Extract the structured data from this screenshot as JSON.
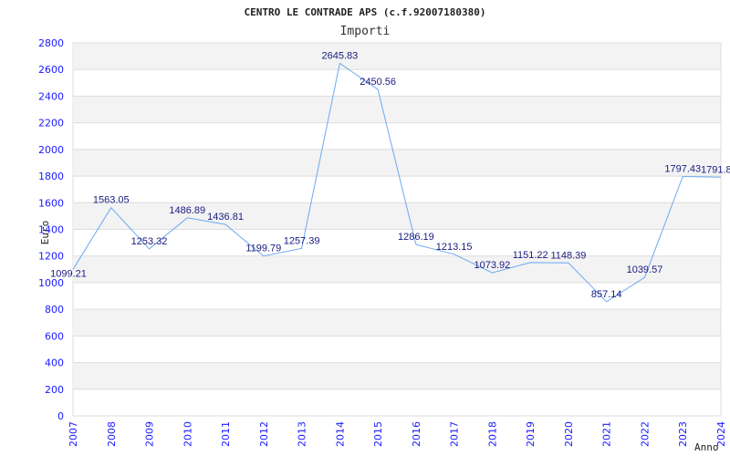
{
  "chart_data": {
    "type": "line",
    "title": "CENTRO LE CONTRADE APS (c.f.92007180380)",
    "subtitle": "Importi",
    "xlabel": "Anno",
    "ylabel": "Euro",
    "ylim": [
      0,
      2800
    ],
    "yticks": [
      "0",
      "200",
      "400",
      "600",
      "800",
      "1000",
      "1200",
      "1400",
      "1600",
      "1800",
      "2000",
      "2200",
      "2400",
      "2600",
      "2800"
    ],
    "categories": [
      "2007",
      "2008",
      "2009",
      "2010",
      "2011",
      "2012",
      "2013",
      "2014",
      "2015",
      "2016",
      "2017",
      "2018",
      "2019",
      "2020",
      "2021",
      "2022",
      "2023",
      "2024"
    ],
    "values": [
      1099.21,
      1563.05,
      1253.32,
      1486.89,
      1436.81,
      1199.79,
      1257.39,
      2645.83,
      2450.56,
      1286.19,
      1213.15,
      1073.92,
      1151.22,
      1148.39,
      857.14,
      1039.57,
      1797.43,
      1791.8
    ],
    "labels": [
      "1099.21",
      "1563.05",
      "1253.32",
      "1486.89",
      "1436.81",
      "1199.79",
      "1257.39",
      "2645.83",
      "2450.56",
      "1286.19",
      "1213.15",
      "1073.92",
      "1151.22",
      "1148.39",
      "857.14",
      "1039.57",
      "1797.43",
      "1791.8"
    ],
    "grid": true,
    "line_color": "#6aaaf0",
    "band_color": "#f3f3f3"
  }
}
